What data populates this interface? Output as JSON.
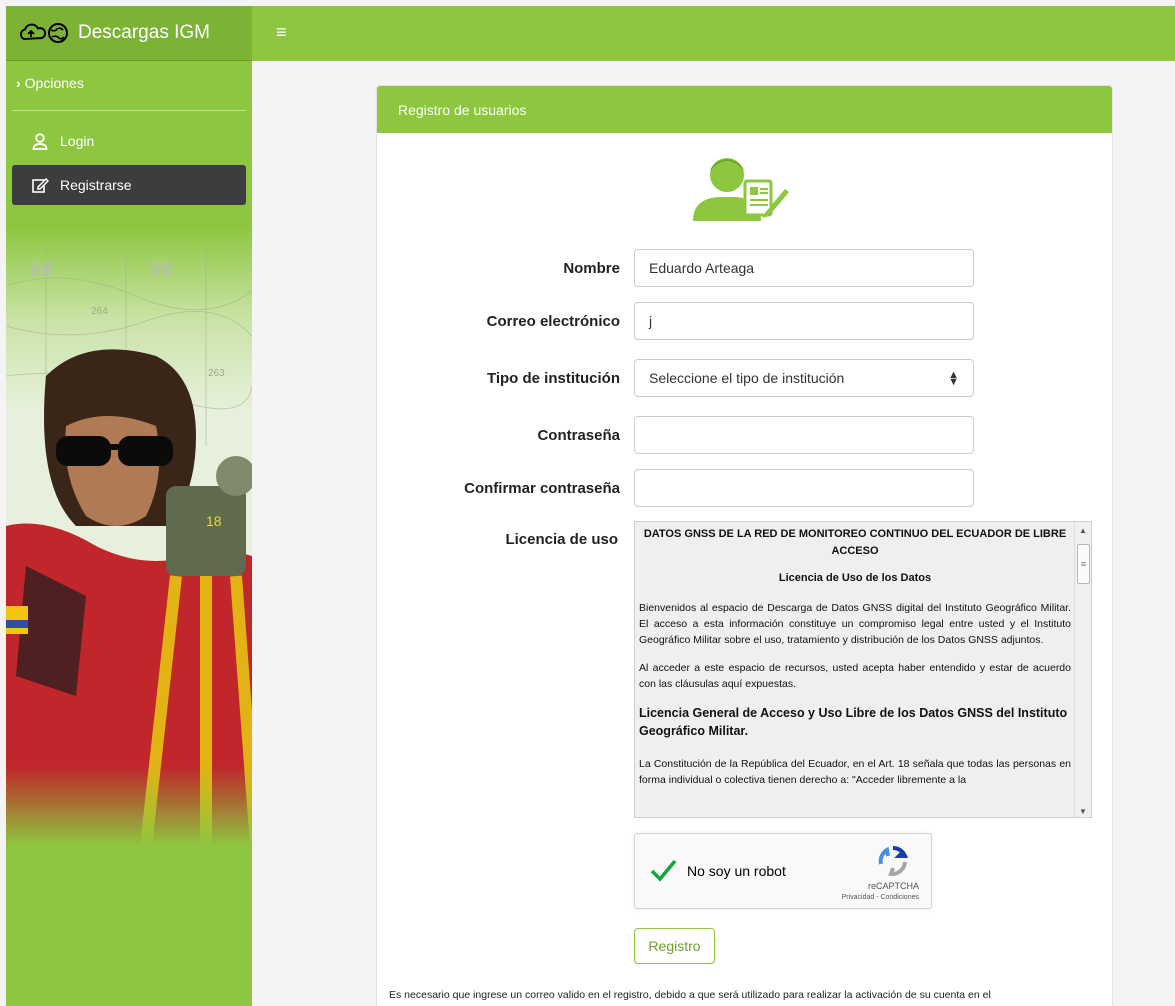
{
  "brand": {
    "title": "Descargas IGM"
  },
  "sidebar": {
    "options_label": "Opciones",
    "items": [
      {
        "label": "Login",
        "icon": "user-icon",
        "active": false
      },
      {
        "label": "Registrarse",
        "icon": "edit-icon",
        "active": true
      }
    ]
  },
  "card": {
    "header": "Registro de usuarios",
    "form": {
      "nombre": {
        "label": "Nombre",
        "value": "Eduardo Arteaga"
      },
      "correo": {
        "label": "Correo electrónico",
        "value": "j"
      },
      "tipo": {
        "label": "Tipo de institución",
        "value": "Seleccione el tipo de institución"
      },
      "password": {
        "label": "Contraseña",
        "value": ""
      },
      "confirm": {
        "label": "Confirmar contraseña",
        "value": ""
      },
      "license_label": "Licencia de uso"
    },
    "license": {
      "title": "DATOS GNSS DE LA RED DE MONITOREO CONTINUO DEL ECUADOR DE LIBRE ACCESO",
      "subtitle": "Licencia de Uso de los Datos",
      "p1": "Bienvenidos al espacio de Descarga de Datos GNSS digital del Instituto Geográfico Militar. El acceso a esta información constituye un compromiso legal entre usted y el Instituto Geográfico Militar sobre el uso, tratamiento y distribución de los Datos GNSS adjuntos.",
      "p2": "Al acceder a este espacio de recursos, usted acepta haber entendido y estar de acuerdo con las cláusulas aquí expuestas.",
      "h3": "Licencia General de Acceso y Uso Libre de los Datos GNSS del Instituto Geográfico Militar.",
      "p3": "La Constitución de la República del Ecuador, en el Art. 18 señala que todas las personas en forma individual o colectiva tienen derecho a: \"Acceder libremente a la"
    },
    "captcha": {
      "label": "No soy un robot",
      "brand": "reCAPTCHA",
      "links": "Privacidad - Condiciones"
    },
    "register_button": "Registro",
    "footnote": "Es necesario que ingrese un correo valido en el registro, debido a que será utilizado para realizar la activación de su cuenta en el"
  },
  "colors": {
    "accent": "#8dc63f",
    "active_item": "#3d3d3d"
  }
}
